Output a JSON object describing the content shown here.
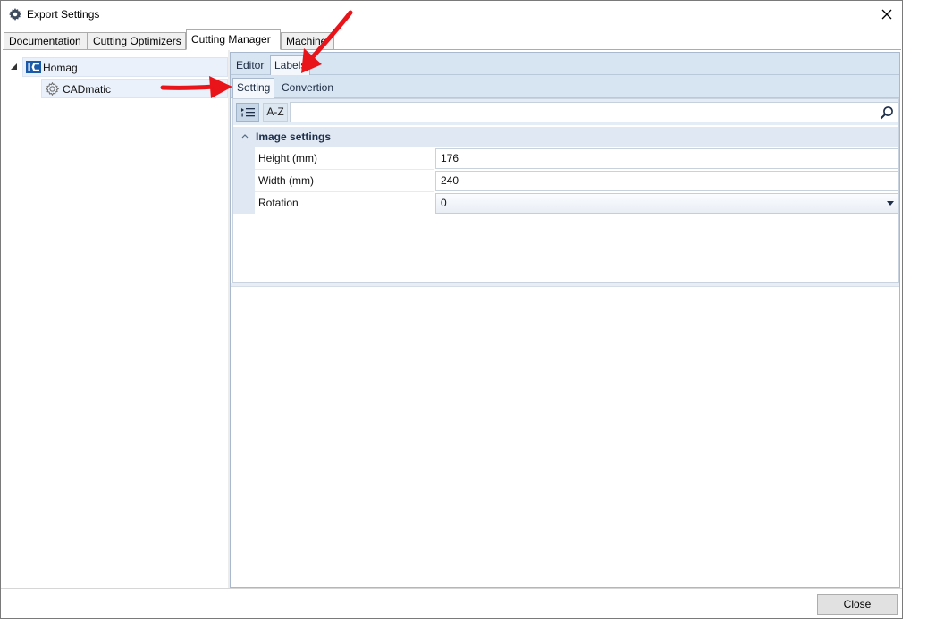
{
  "window": {
    "title": "Export Settings"
  },
  "main_tabs": [
    {
      "label": "Documentation",
      "active": false
    },
    {
      "label": "Cutting Optimizers",
      "active": false
    },
    {
      "label": "Cutting Manager",
      "active": true
    },
    {
      "label": "Machine",
      "active": false
    }
  ],
  "tree": {
    "items": [
      {
        "label": "Homag",
        "icon": "homag-logo-icon",
        "expanded": true,
        "selected": true
      },
      {
        "label": "CADmatic",
        "icon": "gear-icon",
        "selected": true
      }
    ]
  },
  "editor_tabs": [
    {
      "label": "Editor",
      "active": false
    },
    {
      "label": "Labels",
      "active": true
    }
  ],
  "labels_tabs": [
    {
      "label": "Setting",
      "active": true
    },
    {
      "label": "Convertion",
      "active": false
    }
  ],
  "property_grid": {
    "toolbar": {
      "categorized_icon": "categorized-list-icon",
      "alphabetical_label": "A-Z",
      "search_value": "",
      "search_icon": "search-icon"
    },
    "category": {
      "label": "Image settings",
      "expanded": true
    },
    "properties": [
      {
        "name": "Height (mm)",
        "value": "176",
        "type": "text"
      },
      {
        "name": "Width (mm)",
        "value": "240",
        "type": "text"
      },
      {
        "name": "Rotation",
        "value": "0",
        "type": "dropdown"
      }
    ]
  },
  "footer": {
    "close_label": "Close"
  },
  "annotations": {
    "arrow_color": "#e8141a"
  }
}
